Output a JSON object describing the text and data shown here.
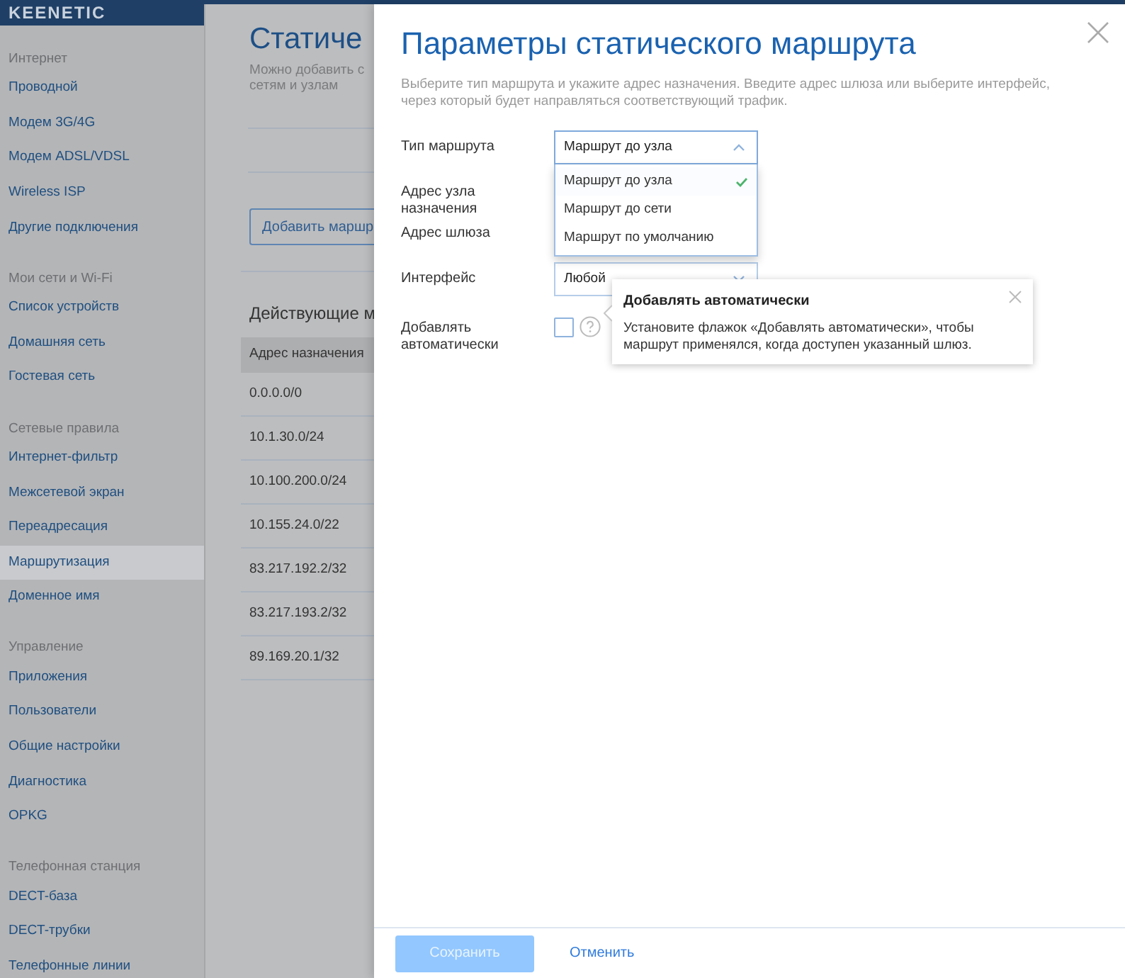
{
  "sidebar": {
    "logo": "KEENETIC",
    "groups": [
      {
        "title": "Интернет",
        "items": [
          {
            "label": "Проводной",
            "selected": false
          },
          {
            "label": "Модем 3G/4G",
            "selected": false
          },
          {
            "label": "Модем ADSL/VDSL",
            "selected": false
          },
          {
            "label": "Wireless ISP",
            "selected": false
          },
          {
            "label": "Другие подключения",
            "selected": false
          }
        ]
      },
      {
        "title": "Мои сети и Wi-Fi",
        "items": [
          {
            "label": "Список устройств",
            "selected": false
          },
          {
            "label": "Домашняя сеть",
            "selected": false
          },
          {
            "label": "Гостевая сеть",
            "selected": false
          }
        ]
      },
      {
        "title": "Сетевые правила",
        "items": [
          {
            "label": "Интернет-фильтр",
            "selected": false
          },
          {
            "label": "Межсетевой экран",
            "selected": false
          },
          {
            "label": "Переадресация",
            "selected": false
          },
          {
            "label": "Маршрутизация",
            "selected": true
          },
          {
            "label": "Доменное имя",
            "selected": false
          }
        ]
      },
      {
        "title": "Управление",
        "items": [
          {
            "label": "Приложения",
            "selected": false
          },
          {
            "label": "Пользователи",
            "selected": false
          },
          {
            "label": "Общие настройки",
            "selected": false
          },
          {
            "label": "Диагностика",
            "selected": false
          },
          {
            "label": "OPKG",
            "selected": false
          }
        ]
      },
      {
        "title": "Телефонная станция",
        "items": [
          {
            "label": "DECT-база",
            "selected": false
          },
          {
            "label": "DECT-трубки",
            "selected": false
          },
          {
            "label": "Телефонные линии",
            "selected": false
          }
        ]
      }
    ]
  },
  "page": {
    "title": "Статиче",
    "description": [
      "Можно добавить с",
      "сетям и узлам"
    ],
    "add_button": "Добавить маршр",
    "section_title": "Действующие м",
    "table": {
      "columns": [
        "Адрес назначения"
      ],
      "rows": [
        "0.0.0.0/0",
        "10.1.30.0/24",
        "10.100.200.0/24",
        "10.155.24.0/22",
        "83.217.192.2/32",
        "83.217.193.2/32",
        "89.169.20.1/32"
      ]
    }
  },
  "panel": {
    "title": "Параметры статического маршрута",
    "description": "Выберите тип маршрута и укажите адрес назначения. Введите адрес шлюза или выберите интерфейс, через который будет направляться соответствующий трафик.",
    "fields": [
      {
        "kind": "select",
        "label": "Тип маршрута",
        "value": "Маршрут до узла",
        "expanded": true,
        "options": [
          {
            "label": "Маршрут до узла",
            "selected": true
          },
          {
            "label": "Маршрут до сети",
            "selected": false
          },
          {
            "label": "Маршрут по умолчанию",
            "selected": false
          }
        ]
      },
      {
        "kind": "covered",
        "label": "Адрес узла назначения"
      },
      {
        "kind": "covered",
        "label": "Адрес шлюза"
      },
      {
        "kind": "select",
        "label": "Интерфейс",
        "value": "Любой",
        "expanded": false
      },
      {
        "kind": "checkbox",
        "label": "Добавлять автоматически",
        "checked": false
      }
    ],
    "tooltip": {
      "title": "Добавлять автоматически",
      "text": "Установите флажок «Добавлять автоматически», чтобы маршрут применялся, когда доступен указанный шлюз."
    },
    "save_button": {
      "label": "Сохранить",
      "disabled": true
    },
    "cancel_link": "Отменить"
  }
}
